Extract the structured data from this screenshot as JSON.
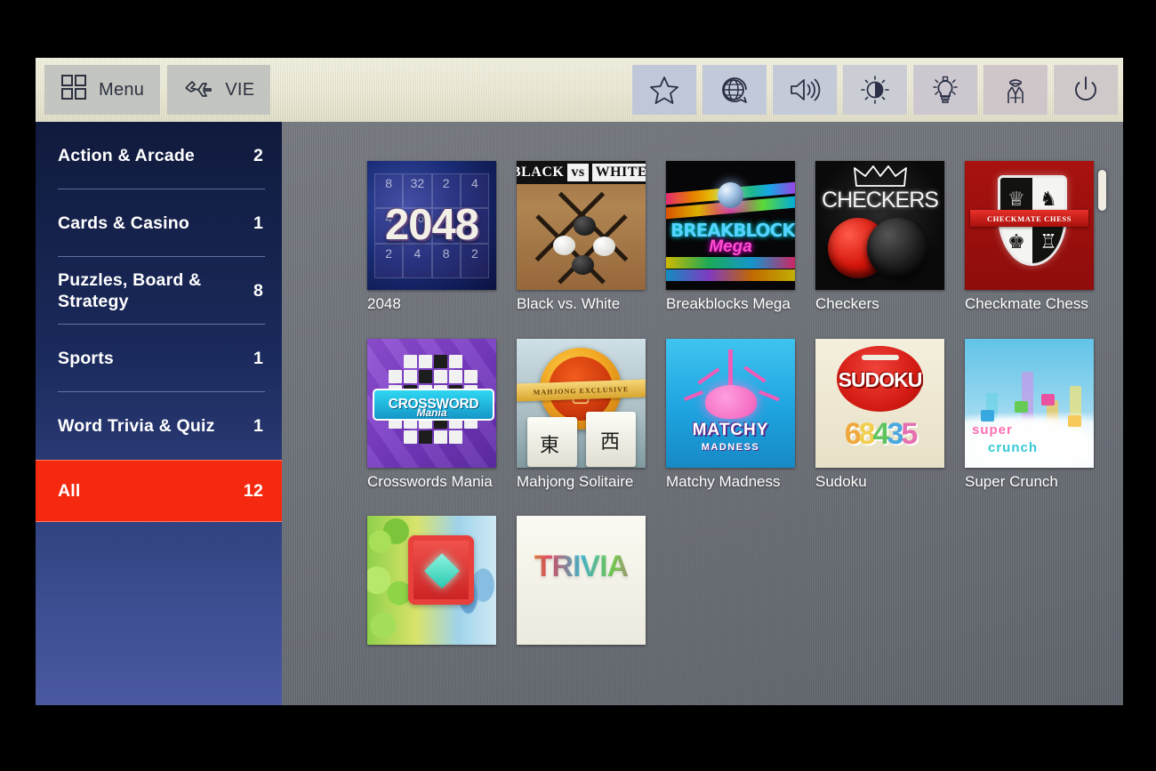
{
  "toolbar": {
    "left_buttons": [
      {
        "label": "Menu",
        "icon": "grid-menu-icon"
      },
      {
        "label": "VIE",
        "icon": "airplane-icon"
      }
    ],
    "right_buttons": [
      {
        "icon": "star-icon",
        "name": "favorites-button"
      },
      {
        "icon": "globe-chat-icon",
        "name": "language-button"
      },
      {
        "icon": "speaker-icon",
        "name": "volume-button"
      },
      {
        "icon": "brightness-icon",
        "name": "brightness-button"
      },
      {
        "icon": "lightbulb-icon",
        "name": "reading-light-button"
      },
      {
        "icon": "flight-attendant-icon",
        "name": "call-crew-button"
      },
      {
        "icon": "power-icon",
        "name": "power-button"
      }
    ]
  },
  "sidebar": {
    "items": [
      {
        "label": "Action & Arcade",
        "count": "2",
        "selected": false
      },
      {
        "label": "Cards & Casino",
        "count": "1",
        "selected": false
      },
      {
        "label": "Puzzles, Board & Strategy",
        "count": "8",
        "selected": false
      },
      {
        "label": "Sports",
        "count": "1",
        "selected": false
      },
      {
        "label": "Word Trivia & Quiz",
        "count": "1",
        "selected": false
      },
      {
        "label": "All",
        "count": "12",
        "selected": true
      }
    ]
  },
  "grid": {
    "tiles": [
      {
        "label": "2048",
        "art": "a2048",
        "art_text": {
          "cells": [
            "8",
            "32",
            "2",
            "4",
            "4",
            "16",
            "32",
            "8",
            "2",
            "4",
            "8",
            "2"
          ],
          "headline": "2048"
        }
      },
      {
        "label": "Black vs. White",
        "art": "abw",
        "art_text": {
          "word1": "BLACK",
          "sep": "vs",
          "word2": "WHITE"
        }
      },
      {
        "label": "Breakblocks Mega",
        "art": "abb",
        "art_text": {
          "line1": "BREAKBLOCKS",
          "line2": "Mega"
        }
      },
      {
        "label": "Checkers",
        "art": "ack",
        "art_text": {
          "headline": "CHECKERS"
        }
      },
      {
        "label": "Checkmate Chess",
        "art": "acc",
        "art_text": {
          "ribbon": "CHECKMATE CHESS"
        }
      },
      {
        "label": "Crosswords Mania",
        "art": "acm",
        "art_text": {
          "line1": "CROSSWORD",
          "line2": "Mania"
        }
      },
      {
        "label": "Mahjong Solitaire",
        "art": "amj",
        "art_text": {
          "ribbon": "MAHJONG EXCLUSIVE",
          "glyph1": "東",
          "glyph2": "西",
          "glyph3": "中"
        }
      },
      {
        "label": "Matchy Madness",
        "art": "amm",
        "art_text": {
          "line1": "MATCHY",
          "line2": "MADNESS"
        }
      },
      {
        "label": "Sudoku",
        "art": "asd",
        "art_text": {
          "headline": "SUDOKU",
          "numbers": [
            "6",
            "8",
            "4",
            "3",
            "5"
          ]
        }
      },
      {
        "label": "Super Crunch",
        "art": "asc",
        "art_text": {
          "line1": "super",
          "line2": "crunch"
        }
      },
      {
        "label": "",
        "art": "ajw",
        "art_text": {}
      },
      {
        "label": "",
        "art": "atr",
        "art_text": {
          "headline": "TRIVIA"
        }
      }
    ]
  },
  "scrollbar": {
    "position_percent": "8"
  },
  "colors": {
    "selected_item": "#f5290f",
    "sidebar_top": "#101a3c",
    "sidebar_bottom": "#4a59a0",
    "toolbar": "#eae8d2",
    "content_bg": "#6e7278"
  }
}
